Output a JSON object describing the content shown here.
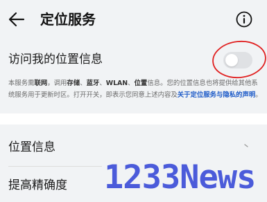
{
  "header": {
    "title": "定位服务",
    "back_icon": "arrow-left-icon",
    "info_icon": "info-circle-icon"
  },
  "location_access": {
    "label": "访问我的位置信息",
    "toggle_state": "off",
    "annotation_color": "#e02020"
  },
  "description": {
    "part1": "本服务需",
    "internet": "联网",
    "part2": "，调用",
    "storage": "存储",
    "sep1": "、",
    "bluetooth": "蓝牙",
    "sep2": "、",
    "wlan": "WLAN",
    "sep3": "、",
    "location": "位置",
    "part3": "信息。您的位置信息也将提供给其他系统服务用于更新时区。打开开关，即表示您同意上述内容及",
    "link": "关于定位服务与隐私的声明",
    "part4": "。",
    "link_color": "#1f5cc8"
  },
  "settings": {
    "items": [
      {
        "label": "位置信息"
      },
      {
        "label": "提高精确度"
      }
    ]
  },
  "watermark": {
    "text": "1233News",
    "color": "#3d4fd8"
  }
}
